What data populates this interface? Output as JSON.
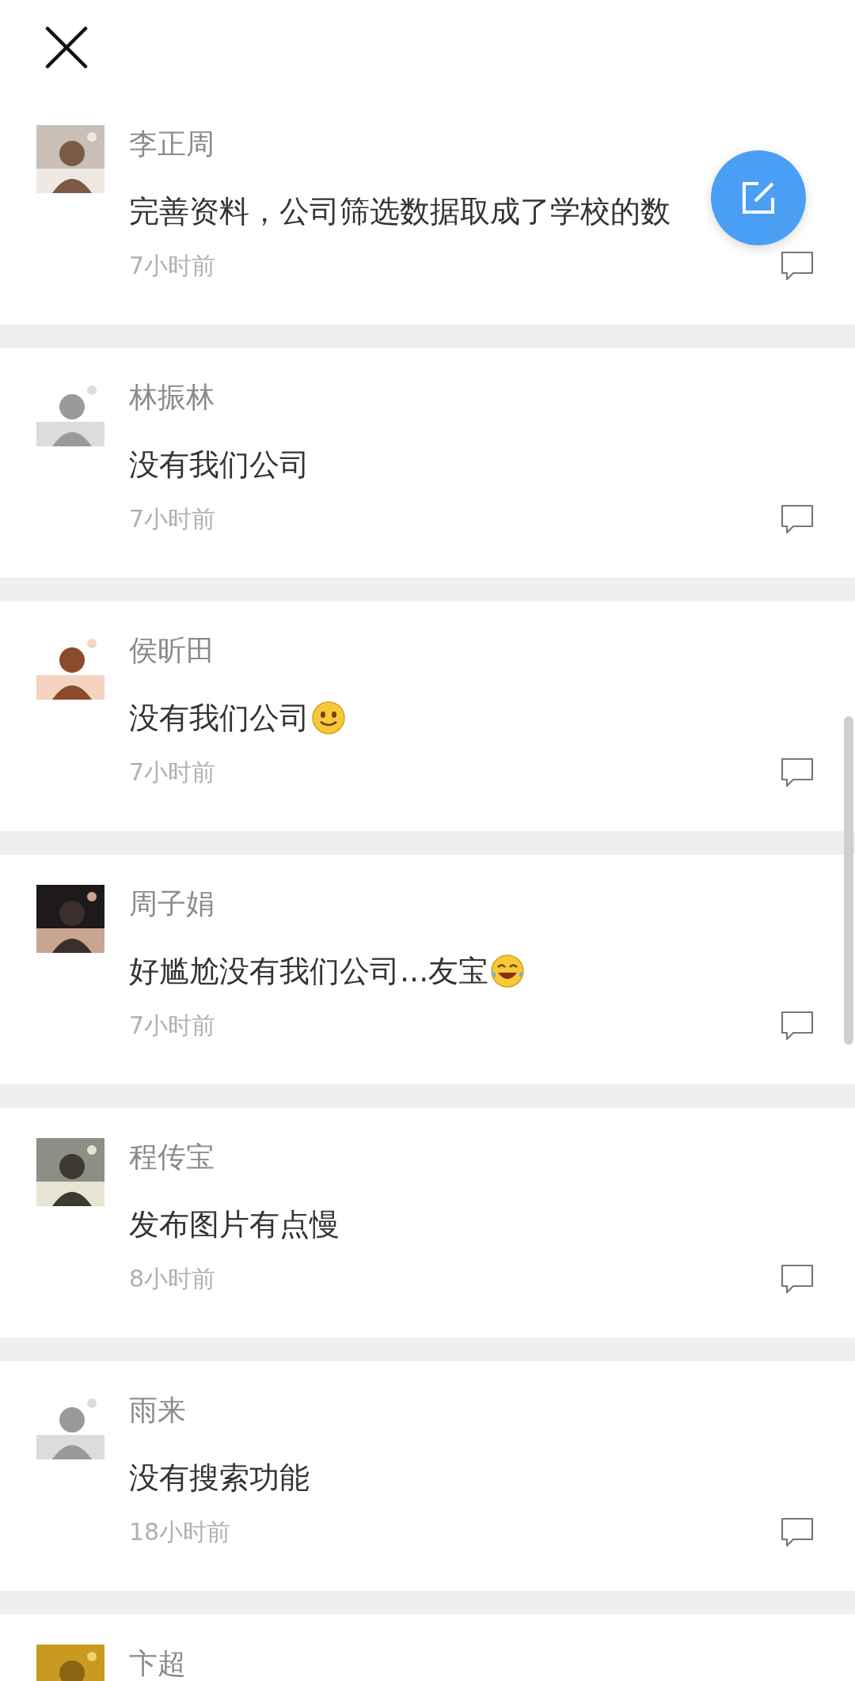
{
  "posts": [
    {
      "name": "李正周",
      "message": "完善资料，公司筛选数据取成了学校的数",
      "time": "7小时前"
    },
    {
      "name": "林振林",
      "message": "没有我们公司",
      "time": "7小时前"
    },
    {
      "name": "侯昕田",
      "message": "没有我们公司",
      "emoji": {
        "kind": "smile"
      },
      "time": "7小时前"
    },
    {
      "name": "周子娟",
      "message": "好尴尬没有我们公司...友宝",
      "emoji": {
        "kind": "laugh"
      },
      "time": "7小时前"
    },
    {
      "name": "程传宝",
      "message": "发布图片有点慢",
      "time": "8小时前"
    },
    {
      "name": "雨来",
      "message": "没有搜索功能",
      "time": "18小时前"
    },
    {
      "name": "卞超"
    }
  ]
}
